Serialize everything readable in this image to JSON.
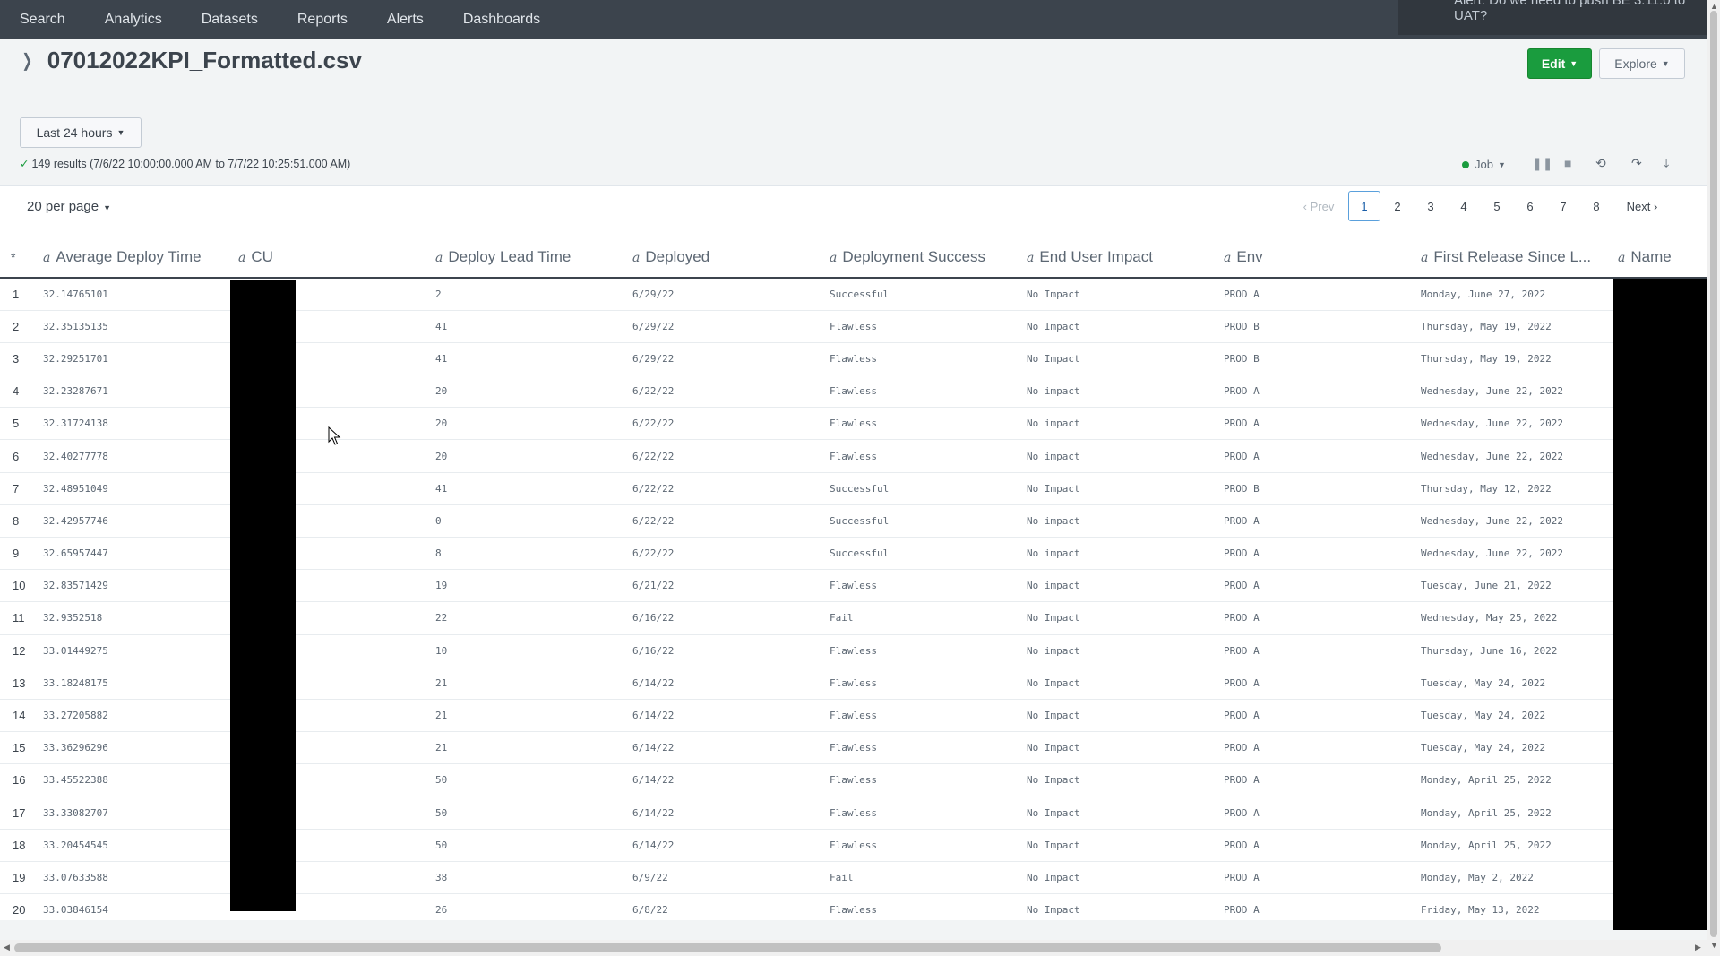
{
  "nav": {
    "items": [
      "Search",
      "Analytics",
      "Datasets",
      "Reports",
      "Alerts",
      "Dashboards"
    ]
  },
  "toast": {
    "text": "Alert: Do we need to push BE 3.11.0 to UAT?"
  },
  "header": {
    "title": "07012022KPI_Formatted.csv",
    "edit_label": "Edit",
    "explore_label": "Explore"
  },
  "timepicker": {
    "label": "Last 24 hours"
  },
  "results": {
    "summary": "149 results (7/6/22 10:00:00.000 AM to 7/7/22 10:25:51.000 AM)"
  },
  "job": {
    "label": "Job"
  },
  "pagination": {
    "per_page": "20 per page",
    "prev": "Prev",
    "next": "Next",
    "pages": [
      "1",
      "2",
      "3",
      "4",
      "5",
      "6",
      "7",
      "8"
    ],
    "current": "1"
  },
  "table": {
    "row_marker": "*",
    "type_glyph": "a",
    "columns": [
      "Average Deploy Time",
      "CU",
      "Deploy Lead Time",
      "Deployed",
      "Deployment Success",
      "End User Impact",
      "Env",
      "First Release Since L...",
      "Name"
    ],
    "rows": [
      [
        "1",
        "32.14765101",
        "",
        "2",
        "6/29/22",
        "Successful",
        "No Impact",
        "PROD A",
        "Monday, June 27, 2022",
        ""
      ],
      [
        "2",
        "32.35135135",
        "",
        "41",
        "6/29/22",
        "Flawless",
        "No Impact",
        "PROD B",
        "Thursday, May 19, 2022",
        ""
      ],
      [
        "3",
        "32.29251701",
        "",
        "41",
        "6/29/22",
        "Flawless",
        "No Impact",
        "PROD B",
        "Thursday, May 19, 2022",
        ""
      ],
      [
        "4",
        "32.23287671",
        "",
        "20",
        "6/22/22",
        "Flawless",
        "No impact",
        "PROD A",
        "Wednesday, June 22, 2022",
        ""
      ],
      [
        "5",
        "32.31724138",
        "",
        "20",
        "6/22/22",
        "Flawless",
        "No impact",
        "PROD A",
        "Wednesday, June 22, 2022",
        ""
      ],
      [
        "6",
        "32.40277778",
        "",
        "20",
        "6/22/22",
        "Flawless",
        "No impact",
        "PROD A",
        "Wednesday, June 22, 2022",
        ""
      ],
      [
        "7",
        "32.48951049",
        "",
        "41",
        "6/22/22",
        "Successful",
        "No Impact",
        "PROD B",
        "Thursday, May 12, 2022",
        ""
      ],
      [
        "8",
        "32.42957746",
        "",
        "0",
        "6/22/22",
        "Successful",
        "No impact",
        "PROD A",
        "Wednesday, June 22, 2022",
        ""
      ],
      [
        "9",
        "32.65957447",
        "",
        "8",
        "6/22/22",
        "Successful",
        "No impact",
        "PROD A",
        "Wednesday, June 22, 2022",
        ""
      ],
      [
        "10",
        "32.83571429",
        "",
        "19",
        "6/21/22",
        "Flawless",
        "No impact",
        "PROD A",
        "Tuesday, June 21, 2022",
        ""
      ],
      [
        "11",
        "32.9352518",
        "",
        "22",
        "6/16/22",
        "Fail",
        "No Impact",
        "PROD A",
        "Wednesday, May 25, 2022",
        ""
      ],
      [
        "12",
        "33.01449275",
        "",
        "10",
        "6/16/22",
        "Flawless",
        "No impact",
        "PROD A",
        "Thursday, June 16, 2022",
        ""
      ],
      [
        "13",
        "33.18248175",
        "",
        "21",
        "6/14/22",
        "Flawless",
        "No Impact",
        "PROD A",
        "Tuesday, May 24, 2022",
        ""
      ],
      [
        "14",
        "33.27205882",
        "",
        "21",
        "6/14/22",
        "Flawless",
        "No Impact",
        "PROD A",
        "Tuesday, May 24, 2022",
        ""
      ],
      [
        "15",
        "33.36296296",
        "",
        "21",
        "6/14/22",
        "Flawless",
        "No Impact",
        "PROD A",
        "Tuesday, May 24, 2022",
        ""
      ],
      [
        "16",
        "33.45522388",
        "",
        "50",
        "6/14/22",
        "Flawless",
        "No Impact",
        "PROD A",
        "Monday, April 25, 2022",
        ""
      ],
      [
        "17",
        "33.33082707",
        "",
        "50",
        "6/14/22",
        "Flawless",
        "No Impact",
        "PROD A",
        "Monday, April 25, 2022",
        ""
      ],
      [
        "18",
        "33.20454545",
        "",
        "50",
        "6/14/22",
        "Flawless",
        "No Impact",
        "PROD A",
        "Monday, April 25, 2022",
        ""
      ],
      [
        "19",
        "33.07633588",
        "",
        "38",
        "6/9/22",
        "Fail",
        "No Impact",
        "PROD A",
        "Monday, May 2, 2022",
        ""
      ],
      [
        "20",
        "33.03846154",
        "",
        "26",
        "6/8/22",
        "Flawless",
        "No Impact",
        "PROD A",
        "Friday, May 13, 2022",
        ""
      ]
    ]
  },
  "icons": {
    "chevron": "chevron-right-icon",
    "caret": "caret-down-icon",
    "check": "check-icon",
    "pause": "pause-icon",
    "stop": "stop-icon",
    "refresh": "refresh-icon",
    "share": "share-icon",
    "export": "download-icon"
  },
  "colors": {
    "nav_bg": "#3c444d",
    "edit_green": "#1a9c3e",
    "page_active": "#5aa0dc"
  }
}
